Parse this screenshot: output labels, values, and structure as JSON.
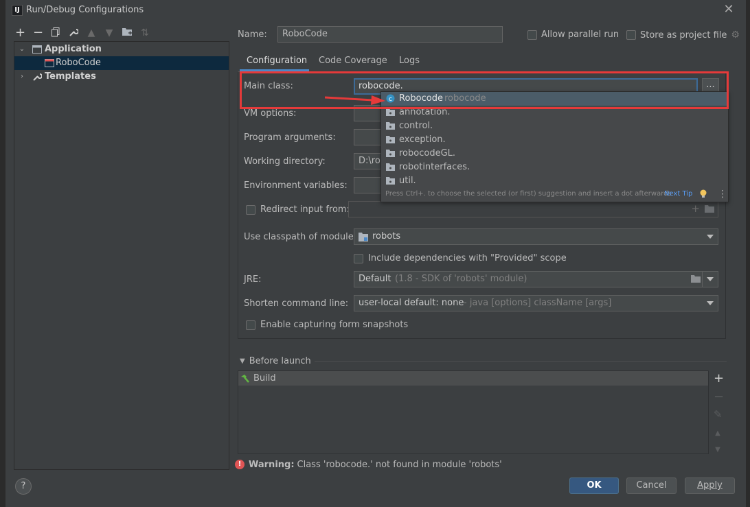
{
  "window": {
    "title": "Run/Debug Configurations",
    "app_icon": "IJ"
  },
  "toolbar": {
    "icons": [
      "add-icon",
      "remove-icon",
      "copy-icon",
      "wrench-icon",
      "move-up-icon",
      "move-down-icon",
      "folder-icon",
      "sort-icon"
    ]
  },
  "tree": {
    "application": "Application",
    "robocode": "RoboCode",
    "templates": "Templates"
  },
  "form": {
    "name_label": "Name:",
    "name_value": "RoboCode",
    "allow_parallel": "Allow parallel run",
    "store_project": "Store as project file",
    "tabs": [
      "Configuration",
      "Code Coverage",
      "Logs"
    ],
    "main_class_label": "Main class:",
    "main_class_value": "robocode.",
    "browse": "...",
    "vm_options_label": "VM options:",
    "program_args_label": "Program arguments:",
    "working_dir_label": "Working directory:",
    "working_dir_value": "D:\\rol",
    "env_vars_label": "Environment variables:",
    "redirect_label": "Redirect input from:",
    "classpath_label": "Use classpath of module:",
    "classpath_value": "robots",
    "include_deps": "Include dependencies with \"Provided\" scope",
    "jre_label": "JRE:",
    "jre_value": "Default",
    "jre_hint": "(1.8 - SDK of 'robots' module)",
    "shorten_label": "Shorten command line:",
    "shorten_value": "user-local default: none",
    "shorten_hint": "- java [options] className [args]",
    "capture_snapshots": "Enable capturing form snapshots"
  },
  "popup": {
    "items": [
      {
        "text": "Robocode",
        "hint": "robocode",
        "icon": "class-icon"
      },
      {
        "text": "annotation.",
        "icon": "package-icon"
      },
      {
        "text": "control.",
        "icon": "package-icon"
      },
      {
        "text": "exception.",
        "icon": "package-icon"
      },
      {
        "text": "robocodeGL.",
        "icon": "package-icon"
      },
      {
        "text": "robotinterfaces.",
        "icon": "package-icon"
      },
      {
        "text": "util.",
        "icon": "package-icon"
      }
    ],
    "footer": "Press Ctrl+. to choose the selected (or first) suggestion and insert a dot afterwards",
    "next_tip": "Next Tip"
  },
  "before_launch": {
    "header": "Before launch",
    "item": "Build"
  },
  "warning": {
    "bold": "Warning:",
    "text": "Class 'robocode.' not found in module 'robots'"
  },
  "buttons": {
    "help": "?",
    "ok": "OK",
    "cancel": "Cancel",
    "apply": "Apply"
  },
  "colors": {
    "accent": "#365880",
    "highlight": "#e53a3a",
    "link": "#589df6",
    "selection": "#0d293e"
  }
}
